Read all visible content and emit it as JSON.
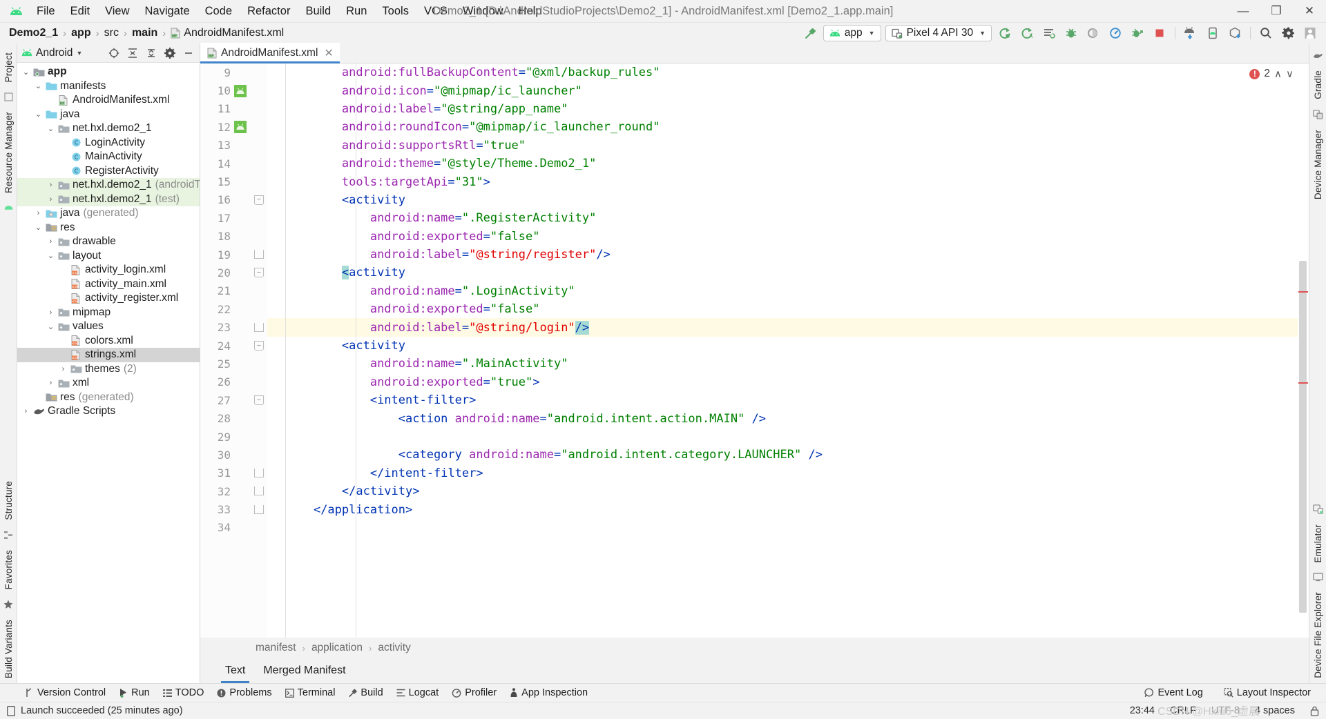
{
  "window": {
    "title": "Demo2_1 [D:\\AndroidStudioProjects\\Demo2_1] - AndroidManifest.xml [Demo2_1.app.main]",
    "minimize": "—",
    "maximize": "❐",
    "close": "✕"
  },
  "menu": [
    {
      "label": "File"
    },
    {
      "label": "Edit"
    },
    {
      "label": "View"
    },
    {
      "label": "Navigate"
    },
    {
      "label": "Code"
    },
    {
      "label": "Refactor"
    },
    {
      "label": "Build"
    },
    {
      "label": "Run"
    },
    {
      "label": "Tools"
    },
    {
      "label": "VCS"
    },
    {
      "label": "Window"
    },
    {
      "label": "Help"
    }
  ],
  "breadcrumb": {
    "items": [
      "Demo2_1",
      "app",
      "src",
      "main"
    ],
    "file": "AndroidManifest.xml",
    "separator": "›"
  },
  "toolbar": {
    "build_hammer": "build-hammer",
    "run_config": "app",
    "device": "Pixel 4 API 30",
    "caret": "▼",
    "icons": [
      "run-icon",
      "debug-run-icon",
      "apply-changes-icon",
      "debug-icon",
      "coverage-icon",
      "profiler-icon",
      "attach-debugger-icon",
      "stop-icon",
      "sdk-manager-icon",
      "avd-manager-icon",
      "sync-gradle-icon",
      "search-everywhere-icon",
      "settings-icon",
      "account-icon"
    ]
  },
  "left_strip": {
    "tabs": [
      "Project",
      "Resource Manager"
    ],
    "bottom_tabs": [
      "Structure",
      "Favorites"
    ],
    "bottom_label": "Build Variants"
  },
  "right_strip": {
    "tabs": [
      "Gradle",
      "Device Manager",
      "Emulator",
      "Device File Explorer"
    ]
  },
  "project_panel": {
    "title": "Android",
    "caret": "▼",
    "header_icons": [
      "target-icon",
      "expand-all-icon",
      "collapse-all-icon",
      "settings-icon",
      "hide-icon"
    ],
    "tree": [
      {
        "depth": 0,
        "twist": "⌄",
        "icon": "module-folder",
        "label": "app",
        "bold": true,
        "dim": "",
        "state": "normal"
      },
      {
        "depth": 1,
        "twist": "⌄",
        "icon": "folder-blue",
        "label": "manifests",
        "bold": false,
        "dim": "",
        "state": "normal"
      },
      {
        "depth": 2,
        "twist": "",
        "icon": "manifest-file",
        "label": "AndroidManifest.xml",
        "bold": false,
        "dim": "",
        "state": "normal"
      },
      {
        "depth": 1,
        "twist": "⌄",
        "icon": "folder-blue",
        "label": "java",
        "bold": false,
        "dim": "",
        "state": "normal"
      },
      {
        "depth": 2,
        "twist": "⌄",
        "icon": "package",
        "label": "net.hxl.demo2_1",
        "bold": false,
        "dim": "",
        "state": "normal"
      },
      {
        "depth": 3,
        "twist": "",
        "icon": "class",
        "label": "LoginActivity",
        "bold": false,
        "dim": "",
        "state": "normal"
      },
      {
        "depth": 3,
        "twist": "",
        "icon": "class",
        "label": "MainActivity",
        "bold": false,
        "dim": "",
        "state": "normal"
      },
      {
        "depth": 3,
        "twist": "",
        "icon": "class",
        "label": "RegisterActivity",
        "bold": false,
        "dim": "",
        "state": "normal"
      },
      {
        "depth": 2,
        "twist": "›",
        "icon": "package",
        "label": "net.hxl.demo2_1",
        "bold": false,
        "dim": "(androidTest)",
        "state": "green"
      },
      {
        "depth": 2,
        "twist": "›",
        "icon": "package",
        "label": "net.hxl.demo2_1",
        "bold": false,
        "dim": "(test)",
        "state": "green"
      },
      {
        "depth": 1,
        "twist": "›",
        "icon": "gen-folder",
        "label": "java",
        "bold": false,
        "dim": "(generated)",
        "state": "normal"
      },
      {
        "depth": 1,
        "twist": "⌄",
        "icon": "res-folder",
        "label": "res",
        "bold": false,
        "dim": "",
        "state": "normal"
      },
      {
        "depth": 2,
        "twist": "›",
        "icon": "package",
        "label": "drawable",
        "bold": false,
        "dim": "",
        "state": "normal"
      },
      {
        "depth": 2,
        "twist": "⌄",
        "icon": "package",
        "label": "layout",
        "bold": false,
        "dim": "",
        "state": "normal"
      },
      {
        "depth": 3,
        "twist": "",
        "icon": "xml-file",
        "label": "activity_login.xml",
        "bold": false,
        "dim": "",
        "state": "normal"
      },
      {
        "depth": 3,
        "twist": "",
        "icon": "xml-file",
        "label": "activity_main.xml",
        "bold": false,
        "dim": "",
        "state": "normal"
      },
      {
        "depth": 3,
        "twist": "",
        "icon": "xml-file",
        "label": "activity_register.xml",
        "bold": false,
        "dim": "",
        "state": "normal"
      },
      {
        "depth": 2,
        "twist": "›",
        "icon": "package",
        "label": "mipmap",
        "bold": false,
        "dim": "",
        "state": "normal"
      },
      {
        "depth": 2,
        "twist": "⌄",
        "icon": "package",
        "label": "values",
        "bold": false,
        "dim": "",
        "state": "normal"
      },
      {
        "depth": 3,
        "twist": "",
        "icon": "xml-file",
        "label": "colors.xml",
        "bold": false,
        "dim": "",
        "state": "normal"
      },
      {
        "depth": 3,
        "twist": "",
        "icon": "xml-file",
        "label": "strings.xml",
        "bold": false,
        "dim": "",
        "state": "selected"
      },
      {
        "depth": 3,
        "twist": "›",
        "icon": "package",
        "label": "themes",
        "bold": false,
        "dim": "(2)",
        "state": "normal"
      },
      {
        "depth": 2,
        "twist": "›",
        "icon": "package",
        "label": "xml",
        "bold": false,
        "dim": "",
        "state": "normal"
      },
      {
        "depth": 1,
        "twist": "",
        "icon": "res-folder",
        "label": "res",
        "bold": false,
        "dim": "(generated)",
        "state": "normal"
      },
      {
        "depth": 0,
        "twist": "›",
        "icon": "gradle",
        "label": "Gradle Scripts",
        "bold": false,
        "dim": "",
        "state": "normal"
      }
    ]
  },
  "editor": {
    "tab": {
      "label": "AndroidManifest.xml",
      "close": "✕",
      "icon": "manifest-file"
    },
    "inspection": {
      "count": "2",
      "up": "∧",
      "down": "∨",
      "icon": "error-icon"
    },
    "first_line": 9,
    "current_line": 23,
    "lines": [
      {
        "n": 9,
        "mark": "",
        "fold": "",
        "tokens": [
          {
            "t": "sp",
            "v": "        "
          },
          {
            "t": "attr",
            "v": "android:fullBackupContent"
          },
          {
            "t": "eq",
            "v": "="
          },
          {
            "t": "val",
            "v": "\"@xml/backup_rules\""
          }
        ]
      },
      {
        "n": 10,
        "mark": "android",
        "fold": "",
        "tokens": [
          {
            "t": "sp",
            "v": "        "
          },
          {
            "t": "attr",
            "v": "android:icon"
          },
          {
            "t": "eq",
            "v": "="
          },
          {
            "t": "val",
            "v": "\"@mipmap/ic_launcher\""
          }
        ]
      },
      {
        "n": 11,
        "mark": "",
        "fold": "",
        "tokens": [
          {
            "t": "sp",
            "v": "        "
          },
          {
            "t": "attr",
            "v": "android:label"
          },
          {
            "t": "eq",
            "v": "="
          },
          {
            "t": "val",
            "v": "\"@string/app_name\""
          }
        ]
      },
      {
        "n": 12,
        "mark": "android",
        "fold": "",
        "tokens": [
          {
            "t": "sp",
            "v": "        "
          },
          {
            "t": "attr",
            "v": "android:roundIcon"
          },
          {
            "t": "eq",
            "v": "="
          },
          {
            "t": "val",
            "v": "\"@mipmap/ic_launcher_round\""
          }
        ]
      },
      {
        "n": 13,
        "mark": "",
        "fold": "",
        "tokens": [
          {
            "t": "sp",
            "v": "        "
          },
          {
            "t": "attr",
            "v": "android:supportsRtl"
          },
          {
            "t": "eq",
            "v": "="
          },
          {
            "t": "val",
            "v": "\"true\""
          }
        ]
      },
      {
        "n": 14,
        "mark": "",
        "fold": "",
        "tokens": [
          {
            "t": "sp",
            "v": "        "
          },
          {
            "t": "attr",
            "v": "android:theme"
          },
          {
            "t": "eq",
            "v": "="
          },
          {
            "t": "val",
            "v": "\"@style/Theme.Demo2_1\""
          }
        ]
      },
      {
        "n": 15,
        "mark": "",
        "fold": "",
        "tokens": [
          {
            "t": "sp",
            "v": "        "
          },
          {
            "t": "attr",
            "v": "tools:targetApi"
          },
          {
            "t": "eq",
            "v": "="
          },
          {
            "t": "val",
            "v": "\"31\""
          },
          {
            "t": "tag",
            "v": ">"
          }
        ]
      },
      {
        "n": 16,
        "mark": "",
        "fold": "tri",
        "tokens": [
          {
            "t": "sp",
            "v": "        "
          },
          {
            "t": "tag",
            "v": "<activity"
          }
        ]
      },
      {
        "n": 17,
        "mark": "",
        "fold": "",
        "tokens": [
          {
            "t": "sp",
            "v": "            "
          },
          {
            "t": "attr",
            "v": "android:name"
          },
          {
            "t": "eq",
            "v": "="
          },
          {
            "t": "val",
            "v": "\".RegisterActivity\""
          }
        ]
      },
      {
        "n": 18,
        "mark": "",
        "fold": "",
        "tokens": [
          {
            "t": "sp",
            "v": "            "
          },
          {
            "t": "attr",
            "v": "android:exported"
          },
          {
            "t": "eq",
            "v": "="
          },
          {
            "t": "val",
            "v": "\"false\""
          }
        ]
      },
      {
        "n": 19,
        "mark": "",
        "fold": "end",
        "tokens": [
          {
            "t": "sp",
            "v": "            "
          },
          {
            "t": "attr",
            "v": "android:label"
          },
          {
            "t": "eq",
            "v": "="
          },
          {
            "t": "err",
            "v": "\"@string/register\""
          },
          {
            "t": "tag",
            "v": "/>"
          }
        ]
      },
      {
        "n": 20,
        "mark": "",
        "fold": "tri",
        "tokens": [
          {
            "t": "sp",
            "v": "        "
          },
          {
            "t": "tag-hl",
            "v": "<"
          },
          {
            "t": "tag",
            "v": "activity"
          }
        ]
      },
      {
        "n": 21,
        "mark": "",
        "fold": "",
        "tokens": [
          {
            "t": "sp",
            "v": "            "
          },
          {
            "t": "attr",
            "v": "android:name"
          },
          {
            "t": "eq",
            "v": "="
          },
          {
            "t": "val",
            "v": "\".LoginActivity\""
          }
        ]
      },
      {
        "n": 22,
        "mark": "",
        "fold": "",
        "tokens": [
          {
            "t": "sp",
            "v": "            "
          },
          {
            "t": "attr",
            "v": "android:exported"
          },
          {
            "t": "eq",
            "v": "="
          },
          {
            "t": "val",
            "v": "\"false\""
          }
        ]
      },
      {
        "n": 23,
        "mark": "",
        "fold": "end",
        "tokens": [
          {
            "t": "sp",
            "v": "            "
          },
          {
            "t": "attr",
            "v": "android:label"
          },
          {
            "t": "eq",
            "v": "="
          },
          {
            "t": "err",
            "v": "\"@string/login\""
          },
          {
            "t": "tag-hl",
            "v": "/>"
          }
        ]
      },
      {
        "n": 24,
        "mark": "",
        "fold": "tri",
        "tokens": [
          {
            "t": "sp",
            "v": "        "
          },
          {
            "t": "tag",
            "v": "<activity"
          }
        ]
      },
      {
        "n": 25,
        "mark": "",
        "fold": "",
        "tokens": [
          {
            "t": "sp",
            "v": "            "
          },
          {
            "t": "attr",
            "v": "android:name"
          },
          {
            "t": "eq",
            "v": "="
          },
          {
            "t": "val",
            "v": "\".MainActivity\""
          }
        ]
      },
      {
        "n": 26,
        "mark": "",
        "fold": "",
        "tokens": [
          {
            "t": "sp",
            "v": "            "
          },
          {
            "t": "attr",
            "v": "android:exported"
          },
          {
            "t": "eq",
            "v": "="
          },
          {
            "t": "val",
            "v": "\"true\""
          },
          {
            "t": "tag",
            "v": ">"
          }
        ]
      },
      {
        "n": 27,
        "mark": "",
        "fold": "tri",
        "tokens": [
          {
            "t": "sp",
            "v": "            "
          },
          {
            "t": "tag",
            "v": "<intent-filter>"
          }
        ]
      },
      {
        "n": 28,
        "mark": "",
        "fold": "",
        "tokens": [
          {
            "t": "sp",
            "v": "                "
          },
          {
            "t": "tag",
            "v": "<action "
          },
          {
            "t": "attr",
            "v": "android:name"
          },
          {
            "t": "eq",
            "v": "="
          },
          {
            "t": "val",
            "v": "\"android.intent.action.MAIN\""
          },
          {
            "t": "sp",
            "v": " "
          },
          {
            "t": "tag",
            "v": "/>"
          }
        ]
      },
      {
        "n": 29,
        "mark": "",
        "fold": "",
        "tokens": []
      },
      {
        "n": 30,
        "mark": "",
        "fold": "",
        "tokens": [
          {
            "t": "sp",
            "v": "                "
          },
          {
            "t": "tag",
            "v": "<category "
          },
          {
            "t": "attr",
            "v": "android:name"
          },
          {
            "t": "eq",
            "v": "="
          },
          {
            "t": "val",
            "v": "\"android.intent.category.LAUNCHER\""
          },
          {
            "t": "sp",
            "v": " "
          },
          {
            "t": "tag",
            "v": "/>"
          }
        ]
      },
      {
        "n": 31,
        "mark": "",
        "fold": "end",
        "tokens": [
          {
            "t": "sp",
            "v": "            "
          },
          {
            "t": "tag",
            "v": "</intent-filter>"
          }
        ]
      },
      {
        "n": 32,
        "mark": "",
        "fold": "end",
        "tokens": [
          {
            "t": "sp",
            "v": "        "
          },
          {
            "t": "tag",
            "v": "</activity>"
          }
        ]
      },
      {
        "n": 33,
        "mark": "",
        "fold": "end",
        "tokens": [
          {
            "t": "sp",
            "v": "    "
          },
          {
            "t": "tag",
            "v": "</application>"
          }
        ]
      },
      {
        "n": 34,
        "mark": "",
        "fold": "",
        "tokens": []
      }
    ]
  },
  "xml_breadcrumb": {
    "items": [
      "manifest",
      "application",
      "activity"
    ],
    "separator": "›"
  },
  "mode_tabs": [
    {
      "label": "Text",
      "active": true
    },
    {
      "label": "Merged Manifest",
      "active": false
    }
  ],
  "tool_window_bar": {
    "buttons": [
      {
        "label": "Version Control",
        "icon": "branch-icon"
      },
      {
        "label": "Run",
        "icon": "run-icon"
      },
      {
        "label": "TODO",
        "icon": "todo-icon"
      },
      {
        "label": "Problems",
        "icon": "problems-icon"
      },
      {
        "label": "Terminal",
        "icon": "terminal-icon"
      },
      {
        "label": "Build",
        "icon": "hammer-icon"
      },
      {
        "label": "Logcat",
        "icon": "logcat-icon"
      },
      {
        "label": "Profiler",
        "icon": "profiler-icon"
      },
      {
        "label": "App Inspection",
        "icon": "inspection-icon"
      }
    ],
    "right_buttons": [
      {
        "label": "Event Log",
        "icon": "event-log-icon"
      },
      {
        "label": "Layout Inspector",
        "icon": "layout-inspector-icon"
      }
    ]
  },
  "status_bar": {
    "message": "Launch succeeded (25 minutes ago)",
    "message_icon": "device-icon",
    "time": "23:44",
    "line_sep": "CRLF",
    "encoding": "UTF-8",
    "indent": "4 spaces",
    "lock_icon": "lock-icon",
    "watermark": "CSDN @Hxiu6_虚晨"
  }
}
